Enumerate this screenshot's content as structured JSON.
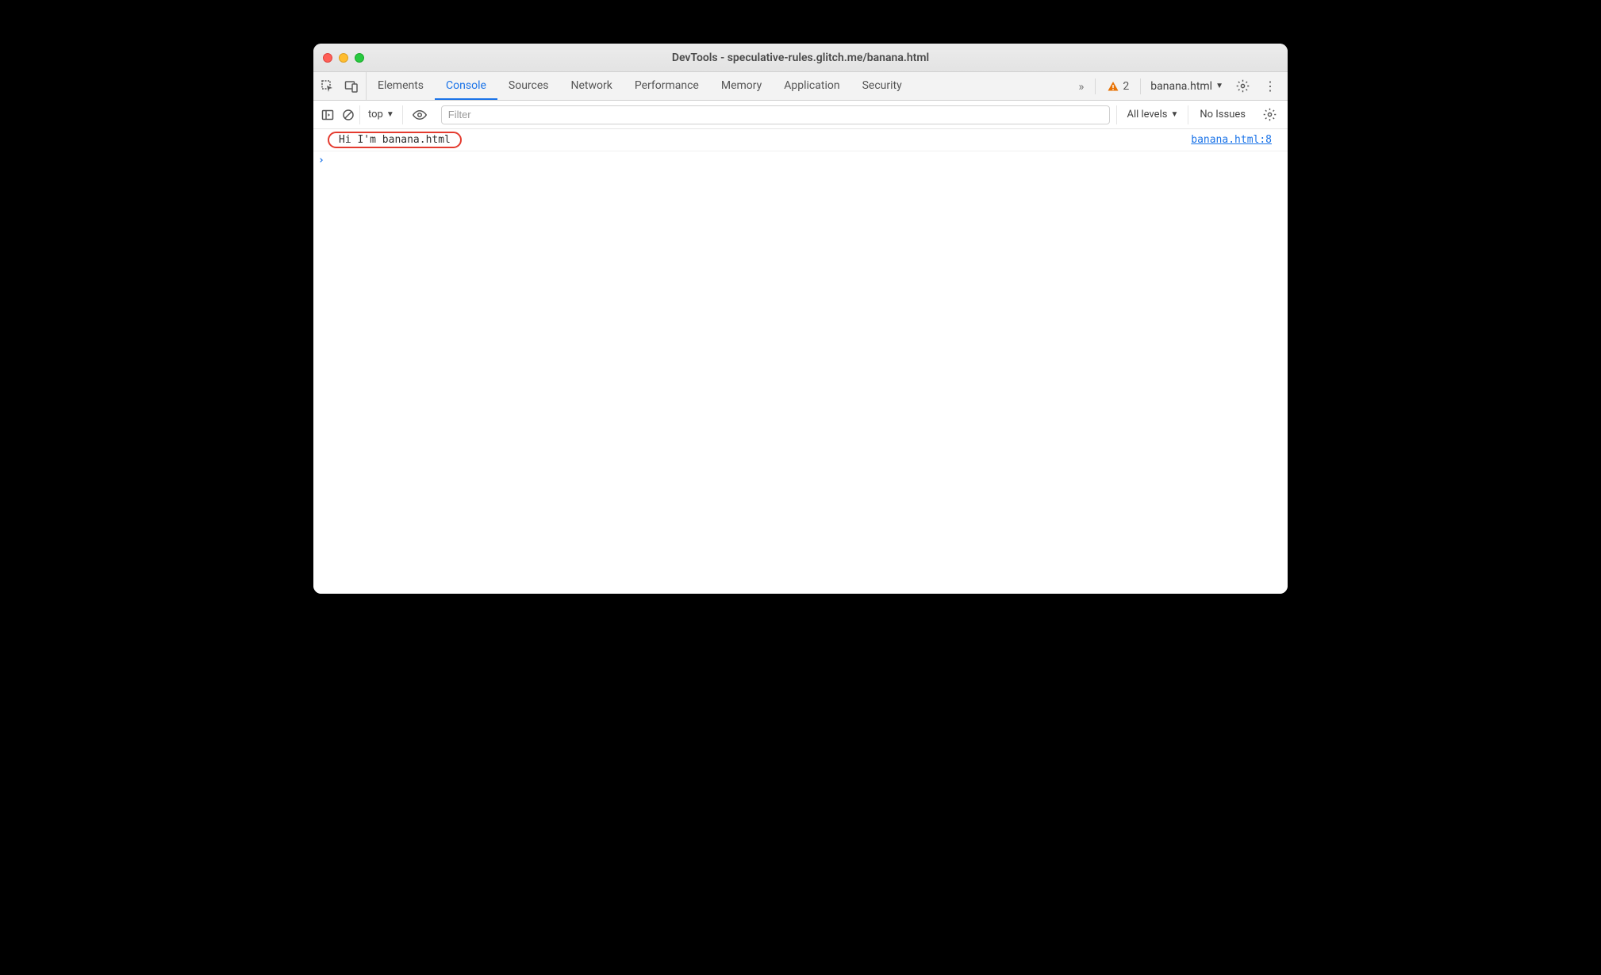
{
  "window": {
    "title": "DevTools - speculative-rules.glitch.me/banana.html"
  },
  "tabs": {
    "items": [
      {
        "label": "Elements"
      },
      {
        "label": "Console"
      },
      {
        "label": "Sources"
      },
      {
        "label": "Network"
      },
      {
        "label": "Performance"
      },
      {
        "label": "Memory"
      },
      {
        "label": "Application"
      },
      {
        "label": "Security"
      }
    ],
    "active_index": 1,
    "more_label": "»",
    "warnings_count": "2",
    "target_label": "banana.html"
  },
  "console_toolbar": {
    "context_label": "top",
    "filter_placeholder": "Filter",
    "filter_value": "",
    "levels_label": "All levels",
    "issues_label": "No Issues"
  },
  "console": {
    "logs": [
      {
        "message": "Hi I'm banana.html",
        "source": "banana.html:8",
        "highlighted": true
      }
    ],
    "prompt": "›"
  }
}
